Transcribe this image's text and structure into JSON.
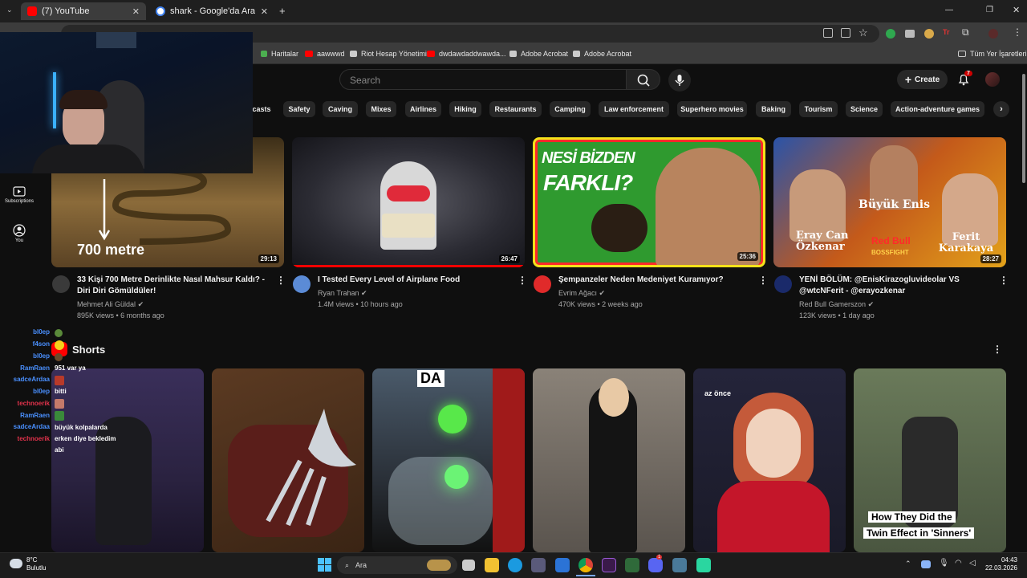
{
  "browser": {
    "tabs": [
      {
        "label": "(7) YouTube",
        "active": true
      },
      {
        "label": "shark - Google'da Ara",
        "active": false
      }
    ],
    "new_tab_icon": "plus-icon",
    "bookmarks": [
      "Haritalar",
      "aawwwd",
      "Riot Hesap Yönetimi",
      "dwdawdaddwawda...",
      "Adobe Acrobat",
      "Adobe Acrobat"
    ],
    "all_bookmarks": "Tüm Yer İşaretleri"
  },
  "youtube": {
    "search_placeholder": "Search",
    "create_label": "Create",
    "notification_count": "7",
    "sidebar": [
      {
        "label": "Subscriptions",
        "icon": "subscriptions-icon"
      },
      {
        "label": "You",
        "icon": "you-icon"
      }
    ],
    "chips": [
      "casts",
      "Safety",
      "Caving",
      "Mixes",
      "Airlines",
      "Hiking",
      "Restaurants",
      "Camping",
      "Law enforcement",
      "Superhero movies",
      "Baking",
      "Tourism",
      "Science",
      "Action-adventure games"
    ],
    "videos": [
      {
        "title": "33 Kişi 700 Metre Derinlikte Nasıl Mahsur Kaldı? - Diri Diri Gömüldüler!",
        "channel": "Mehmet Ali Güldal",
        "meta": "895K views • 6 months ago",
        "duration": "29:13",
        "thumb_text": "700 metre"
      },
      {
        "title": "I Tested Every Level of Airplane Food",
        "channel": "Ryan Trahan",
        "meta": "1.4M views • 10 hours ago",
        "duration": "26:47"
      },
      {
        "title": "Şempanzeler Neden Medeniyet Kuramıyor?",
        "channel": "Evrim Ağacı",
        "meta": "470K views • 2 weeks ago",
        "duration": "25:36",
        "thumb_text_1": "NESİ BİZDEN",
        "thumb_text_2": "FARKLI?"
      },
      {
        "title": "YENİ BÖLÜM: @EnisKirazogluvideolar VS @wtcNFerit - @erayozkenar",
        "channel": "Red Bull Gamerszon",
        "meta": "123K views • 1 day ago",
        "duration": "28:27",
        "thumb_text_1": "Büyük Enis",
        "thumb_text_2": "Eray Can Özkenar",
        "thumb_text_3": "Ferit Karakaya",
        "thumb_text_4": "Red Bull",
        "thumb_text_5": "BOSSFIGHT"
      }
    ],
    "shorts_title": "Shorts",
    "shorts_overlays": [
      "DA",
      "az önce",
      "How They Did the",
      "Twin Effect in 'Sinners'"
    ]
  },
  "chat": [
    {
      "name": "bl0ep",
      "msg": "",
      "color": "#4a90ff"
    },
    {
      "name": "f4son",
      "msg": "",
      "color": "#4a90ff"
    },
    {
      "name": "bl0ep",
      "msg": "",
      "color": "#4a90ff"
    },
    {
      "name": "RamRaen",
      "msg": "951 var ya",
      "color": "#4a90ff"
    },
    {
      "name": "sadceArdaa",
      "msg": "",
      "color": "#4a90ff"
    },
    {
      "name": "bl0ep",
      "msg": "bitti",
      "color": "#4a90ff"
    },
    {
      "name": "technoerik",
      "msg": "",
      "color": "#e0324b"
    },
    {
      "name": "RamRaen",
      "msg": "",
      "color": "#4a90ff"
    },
    {
      "name": "sadceArdaa",
      "msg": "büyük kolpalarda",
      "color": "#4a90ff"
    },
    {
      "name": "technoerik",
      "msg": "erken diye bekledim",
      "color": "#e0324b"
    }
  ],
  "chat_extra": "abi",
  "taskbar": {
    "weather_temp": "8°C",
    "weather_desc": "Bulutlu",
    "search_label": "Ara",
    "time": "04:43",
    "date": "22.03.2026",
    "discord_badge": "1"
  }
}
